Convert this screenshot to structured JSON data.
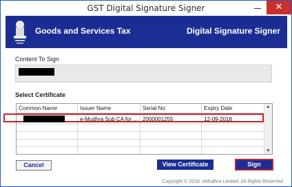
{
  "window": {
    "title": "GST Digital Signature Signer",
    "close_glyph": "✕",
    "minimize_icon": "minimize-icon"
  },
  "banner": {
    "gst_title": "Goods and Services Tax",
    "product_title": "Digital Signature Signer",
    "emblem_icon": "national-emblem-icon"
  },
  "content": {
    "label": "Content To Sign",
    "value_redacted": true
  },
  "certificate": {
    "label": "Select Certificate",
    "columns": [
      "Common Name",
      "Issuer Name",
      "Serial No",
      "Expiry Date"
    ],
    "rows": [
      {
        "common_name": "",
        "issuer_name": "e-Mudhra Sub CA for ...",
        "serial_no": "2000001255",
        "expiry_date": "12-09-2018",
        "selected": true
      }
    ]
  },
  "buttons": {
    "cancel": "Cancel",
    "view": "View Certificate",
    "sign": "Sign"
  },
  "footer": "Copyright © 2016. eMudhra Limited. All Rights Reserved",
  "colors": {
    "brand_navy": "#1b2d93",
    "highlight_red": "#cc1f2a",
    "close_red": "#c9302c"
  }
}
